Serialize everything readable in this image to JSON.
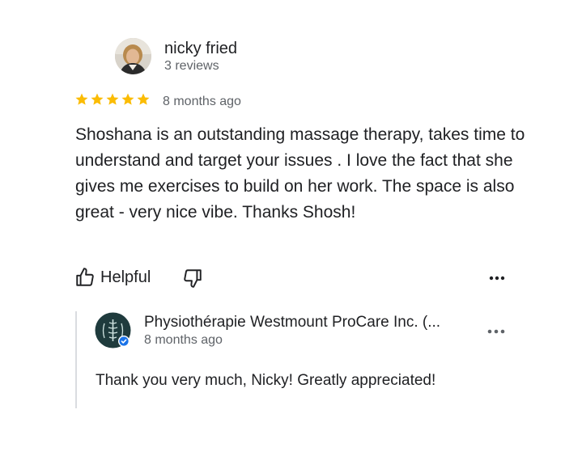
{
  "reviewer": {
    "name": "nicky fried",
    "meta": "3 reviews",
    "avatar_icon": "user-photo"
  },
  "review": {
    "rating": 5,
    "rating_max": 5,
    "date": "8 months ago",
    "text": "Shoshana is an outstanding massage therapy, takes time to understand and target your issues . I love the fact that she gives me exercises to build on her work. The space is also great - very nice vibe. Thanks Shosh!"
  },
  "actions": {
    "helpful_label": "Helpful",
    "helpful_icon": "thumb-up-icon",
    "unhelpful_icon": "thumb-down-icon",
    "more_icon": "more-horizontal-icon"
  },
  "owner_reply": {
    "name": "Physiothérapie Westmount ProCare Inc. (...",
    "date": "8 months ago",
    "text": "Thank you very much, Nicky! Greatly appreciated!",
    "verified_icon": "verified-check-icon",
    "logo_icon": "spine-logo"
  },
  "colors": {
    "star": "#fbbc04",
    "text_primary": "#202124",
    "text_secondary": "#5f6368",
    "verified": "#1a73e8",
    "owner_logo_bg": "#1f3b3d"
  }
}
